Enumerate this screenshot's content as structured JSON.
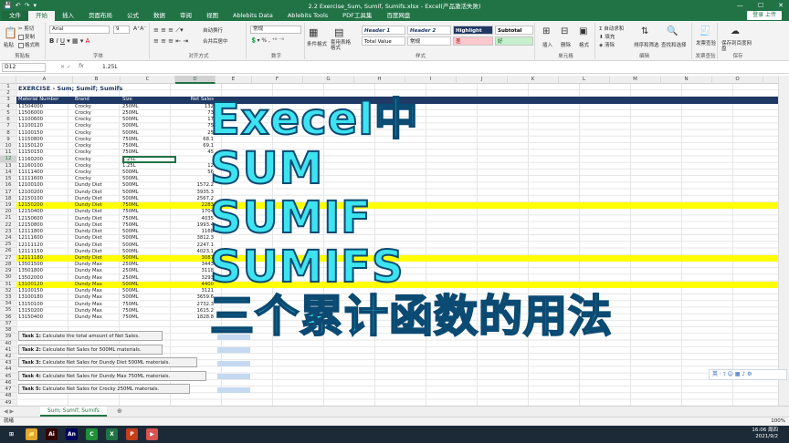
{
  "window": {
    "title": "2.2 Exercise_Sum, Sumif, Sumifs.xlsx - Excel(产品激活失败)",
    "qat": [
      "💾",
      "↶",
      "↷",
      "▾"
    ],
    "controls": [
      "—",
      "☐",
      "✕"
    ]
  },
  "ribbon_tabs": [
    "文件",
    "开始",
    "插入",
    "页面布局",
    "公式",
    "数据",
    "审阅",
    "视图",
    "Ablebits Data",
    "Ablebits Tools",
    "PDF工具集",
    "百度网盘"
  ],
  "share_label": "登录 上传",
  "ribbon": {
    "clipboard": {
      "paste": "粘贴",
      "cut": "✂ 剪切",
      "copy": "复制",
      "format_painter": "格式刷",
      "label": "剪贴板"
    },
    "font": {
      "name": "Arial",
      "size": "9",
      "label": "字体"
    },
    "alignment": {
      "wrap": "自动换行",
      "merge": "合并后居中",
      "label": "对齐方式"
    },
    "number": {
      "format": "常规",
      "label": "数字"
    },
    "styles": {
      "conditional": "条件格式",
      "table": "套用表格格式",
      "cells": [
        {
          "text": "Header 1",
          "bg": "#ffffff",
          "fg": "#1f3864"
        },
        {
          "text": "Header 2",
          "bg": "#ffffff",
          "fg": "#1f3864"
        },
        {
          "text": "Highlight",
          "bg": "#1f3864",
          "fg": "#ffffff"
        },
        {
          "text": "Subtotal",
          "bg": "#ffffff",
          "fg": "#000000"
        },
        {
          "text": "Total Value",
          "bg": "#ffffff",
          "fg": "#000000"
        },
        {
          "text": "常规",
          "bg": "#ffffff",
          "fg": "#000000"
        },
        {
          "text": "差",
          "bg": "#ffc7ce",
          "fg": "#9c0006"
        },
        {
          "text": "好",
          "bg": "#c6efce",
          "fg": "#006100"
        }
      ],
      "label": "样式"
    },
    "cells_group": {
      "insert": "插入",
      "delete": "删除",
      "format": "格式",
      "label": "单元格"
    },
    "editing": {
      "autosum": "自动求和",
      "fill": "填充",
      "clear": "清除",
      "sort": "排序和筛选",
      "find": "查找和选择",
      "label": "编辑"
    },
    "invoice": {
      "btn": "发票查验",
      "label": "发票查验"
    },
    "save": {
      "btn": "保存到百度网盘",
      "label": "保存"
    }
  },
  "formula_bar": {
    "name_box": "D12",
    "fx": "fx",
    "value": "1.25L"
  },
  "columns": [
    "A",
    "B",
    "C",
    "D",
    "E",
    "F",
    "G",
    "H",
    "I",
    "J",
    "K",
    "L",
    "M",
    "N",
    "O",
    "P"
  ],
  "selected_column": "D",
  "selected_row": "12",
  "sheet": {
    "title": "EXERCISE - Sum; Sumif; Sumifs",
    "headers": [
      "Material Number",
      "Brand",
      "Size",
      "Net Sales"
    ],
    "rows": [
      [
        "11504000",
        "Crocky",
        "250ML",
        "132"
      ],
      [
        "11506000",
        "Crocky",
        "250ML",
        "73"
      ],
      [
        "11100600",
        "Crocky",
        "500ML",
        "17"
      ],
      [
        "11100120",
        "Crocky",
        "500ML",
        "75"
      ],
      [
        "11100150",
        "Crocky",
        "500ML",
        "25"
      ],
      [
        "11150800",
        "Crocky",
        "750ML",
        "68.1"
      ],
      [
        "11150120",
        "Crocky",
        "750ML",
        "69.1"
      ],
      [
        "11150150",
        "Crocky",
        "750ML",
        "45"
      ],
      [
        "11160200",
        "Crocky",
        "1.25L",
        ""
      ],
      [
        "11160100",
        "Crocky",
        "1.25L",
        "12"
      ],
      [
        "11111400",
        "Crocky",
        "500ML",
        "56"
      ],
      [
        "11111600",
        "Crocky",
        "500ML",
        ""
      ],
      [
        "12100100",
        "Dundy Diet",
        "500ML",
        "1572.2"
      ],
      [
        "12100200",
        "Dundy Diet",
        "500ML",
        "3935.3"
      ],
      [
        "12150100",
        "Dundy Diet",
        "500ML",
        "2567.2"
      ],
      [
        "12150200",
        "Dundy Diet",
        "750ML",
        "2283"
      ],
      [
        "12150400",
        "Dundy Diet",
        "750ML",
        "1704"
      ],
      [
        "12150600",
        "Dundy Diet",
        "750ML",
        "4035"
      ],
      [
        "12150800",
        "Dundy Diet",
        "750ML",
        "1993.4"
      ],
      [
        "12111800",
        "Dundy Diet",
        "500ML",
        "1168"
      ],
      [
        "12111600",
        "Dundy Diet",
        "500ML",
        "3812.3"
      ],
      [
        "12111120",
        "Dundy Diet",
        "500ML",
        "2247.1"
      ],
      [
        "12111150",
        "Dundy Diet",
        "500ML",
        "4023.1"
      ],
      [
        "12111180",
        "Dundy Diet",
        "500ML",
        "3087"
      ],
      [
        "13501500",
        "Dundy Max",
        "250ML",
        "3443"
      ],
      [
        "13501800",
        "Dundy Max",
        "250ML",
        "3118"
      ],
      [
        "13502000",
        "Dundy Max",
        "250ML",
        "3293"
      ],
      [
        "13100120",
        "Dundy Max",
        "500ML",
        "4400"
      ],
      [
        "13100150",
        "Dundy Max",
        "500ML",
        "3121"
      ],
      [
        "13100180",
        "Dundy Max",
        "500ML",
        "3659.6"
      ],
      [
        "13150100",
        "Dundy Max",
        "750ML",
        "2732.3"
      ],
      [
        "13150200",
        "Dundy Max",
        "750ML",
        "1615.2"
      ],
      [
        "13150400",
        "Dundy Max",
        "750ML",
        "1828.8"
      ]
    ],
    "highlighted": [
      15,
      23,
      27
    ],
    "tasks": [
      {
        "label": "Task 1:",
        "text": " Calculate the total amount of Net Sales."
      },
      {
        "label": "Task 2:",
        "text": " Calculate Net Sales for  500ML materials."
      },
      {
        "label": "Task 3:",
        "text": " Calculate Net Sales for Dundy Diet 500ML materials."
      },
      {
        "label": "Task 4:",
        "text": " Calculate Net Sales for  Dundy Max 750ML materials."
      },
      {
        "label": "Task 5:",
        "text": " Calculate Net Sales for Crocky 250ML materials."
      }
    ]
  },
  "overlay_lines": [
    "Execel中",
    "SUM",
    "SUMIF",
    "SUMIFS",
    "三个累计函数的用法"
  ],
  "sheet_tab": "Sum; Sumif; Sumifs",
  "status": {
    "ready": "就绪",
    "zoom": "100%"
  },
  "ime": "英 · ⁊ ☺ ▦ ♪ ⚙",
  "taskbar": {
    "apps": [
      {
        "label": "⊞",
        "color": "#1c2a38"
      },
      {
        "label": "📁",
        "color": "#e0a82e"
      },
      {
        "label": "Ai",
        "color": "#330000"
      },
      {
        "label": "An",
        "color": "#00005b"
      },
      {
        "label": "C",
        "color": "#1f8f3a"
      },
      {
        "label": "X",
        "color": "#217346"
      },
      {
        "label": "P",
        "color": "#c43e1c"
      },
      {
        "label": "▶",
        "color": "#d9534f"
      }
    ],
    "time": "16:06 周四",
    "date": "2021/9/2"
  }
}
